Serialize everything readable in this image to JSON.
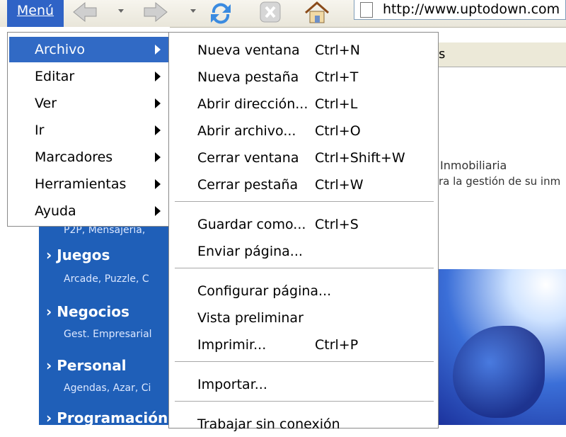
{
  "toolbar": {
    "menu_label": "Menú",
    "address": "http://www.uptodown.com",
    "icons": [
      "back-icon",
      "forward-icon",
      "reload-icon",
      "stop-icon",
      "home-icon",
      "page-icon"
    ]
  },
  "main_menu": {
    "items": [
      {
        "label": "Archivo",
        "active": true
      },
      {
        "label": "Editar"
      },
      {
        "label": "Ver"
      },
      {
        "label": "Ir"
      },
      {
        "label": "Marcadores"
      },
      {
        "label": "Herramientas"
      },
      {
        "label": "Ayuda"
      }
    ]
  },
  "file_menu": {
    "items": [
      {
        "label": "Nueva ventana",
        "shortcut": "Ctrl+N"
      },
      {
        "label": "Nueva pestaña",
        "shortcut": "Ctrl+T"
      },
      {
        "label": "Abrir dirección...",
        "shortcut": "Ctrl+L"
      },
      {
        "label": "Abrir archivo...",
        "shortcut": "Ctrl+O"
      },
      {
        "label": "Cerrar ventana",
        "shortcut": "Ctrl+Shift+W"
      },
      {
        "label": "Cerrar pestaña",
        "shortcut": "Ctrl+W"
      },
      {
        "label": "Guardar como...",
        "shortcut": "Ctrl+S"
      },
      {
        "label": "Enviar página...",
        "shortcut": ""
      },
      {
        "label": "Configurar página...",
        "shortcut": ""
      },
      {
        "label": "Vista preliminar",
        "shortcut": ""
      },
      {
        "label": "Imprimir...",
        "shortcut": "Ctrl+P"
      },
      {
        "label": "Importar...",
        "shortcut": ""
      },
      {
        "label": "Trabajar sin conexión",
        "shortcut": ""
      }
    ]
  },
  "page": {
    "sidebar": [
      {
        "title": "",
        "sub": "P2P, Mensajería,"
      },
      {
        "title": "Juegos",
        "sub": "Arcade, Puzzle, C"
      },
      {
        "title": "Negocios",
        "sub": "Gest. Empresarial"
      },
      {
        "title": "Personal",
        "sub": "Agendas, Azar, Ci"
      },
      {
        "title": "Programación",
        "sub": ""
      }
    ],
    "tab_fragment": "s",
    "inmo_title": "Inmobiliaria",
    "inmo_desc": "ra la gestión de su inm"
  },
  "colors": {
    "menu_blue": "#2f63c6",
    "highlight": "#316ac5",
    "sidebar_blue": "#1f5fb8"
  }
}
